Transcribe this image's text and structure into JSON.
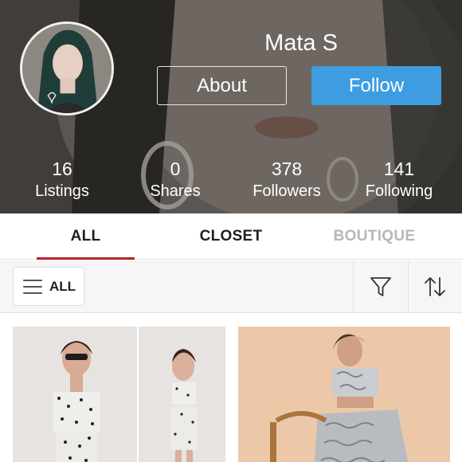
{
  "profile": {
    "name": "Mata S",
    "about_label": "About",
    "follow_label": "Follow"
  },
  "stats": [
    {
      "value": "16",
      "label": "Listings"
    },
    {
      "value": "0",
      "label": "Shares"
    },
    {
      "value": "378",
      "label": "Followers"
    },
    {
      "value": "141",
      "label": "Following"
    }
  ],
  "tabs": [
    {
      "label": "ALL",
      "active": true
    },
    {
      "label": "CLOSET",
      "active": false
    },
    {
      "label": "BOUTIQUE",
      "active": false
    }
  ],
  "filter": {
    "all_label": "ALL"
  },
  "icons": {
    "menu": "hamburger-icon",
    "filter": "funnel-icon",
    "sort": "sort-arrows-icon"
  },
  "colors": {
    "follow_button": "#3d9de0",
    "active_tab_underline": "#b3232b",
    "inactive_tab": "#b7b7b7"
  }
}
